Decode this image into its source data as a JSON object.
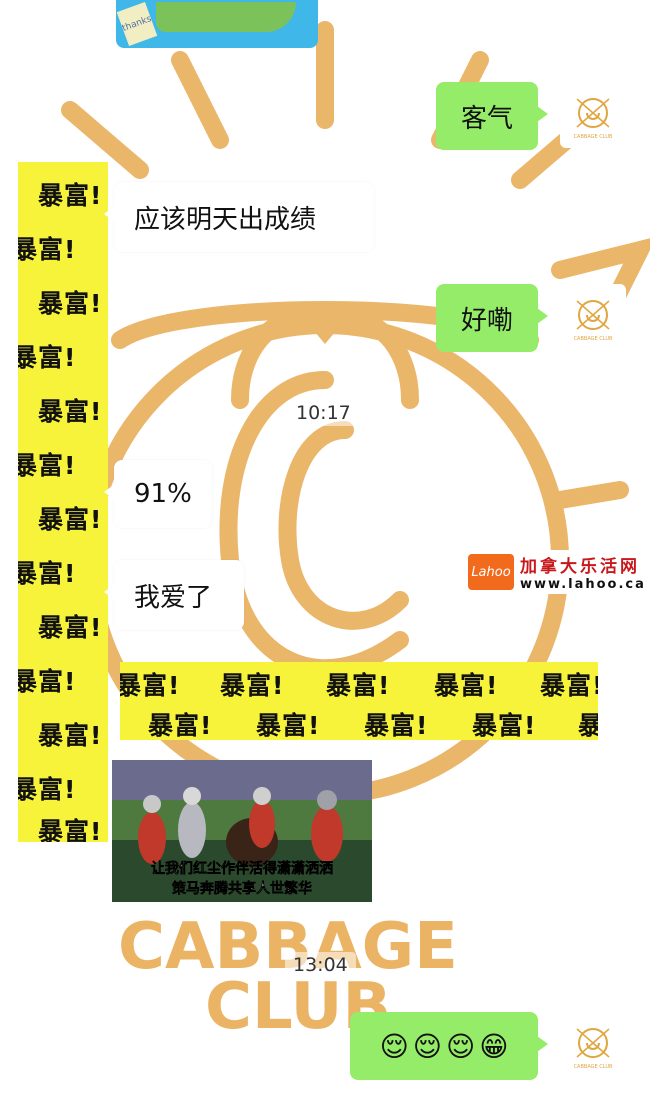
{
  "chat": {
    "messages": {
      "keqi": "客气",
      "tomorrow": "应该明天出成绩",
      "haola": "好嘞",
      "percent": "91%",
      "love": "我爱了",
      "emojis": [
        "😌",
        "😌",
        "😌",
        "😁"
      ]
    },
    "timestamps": [
      "10:17",
      "13:04"
    ]
  },
  "sticker": {
    "text": "暴富!"
  },
  "top_image": {
    "text": "thanks"
  },
  "video": {
    "caption_line1": "让我们红尘作伴活得潇潇洒洒",
    "caption_line2": "策马奔腾共享人世繁华"
  },
  "wallpaper": {
    "brand_line1": "CABBAGE",
    "brand_line2": "CLUB"
  },
  "avatar": {
    "label": "CABBAGE CLUB"
  },
  "watermark": {
    "logo_text": "Lahoo",
    "title": "加拿大乐活网",
    "url": "www.lahoo.ca"
  },
  "colors": {
    "accent_orange": "#e0a640",
    "bubble_green": "#95ec69",
    "sticker_yellow": "#f7f33a"
  }
}
